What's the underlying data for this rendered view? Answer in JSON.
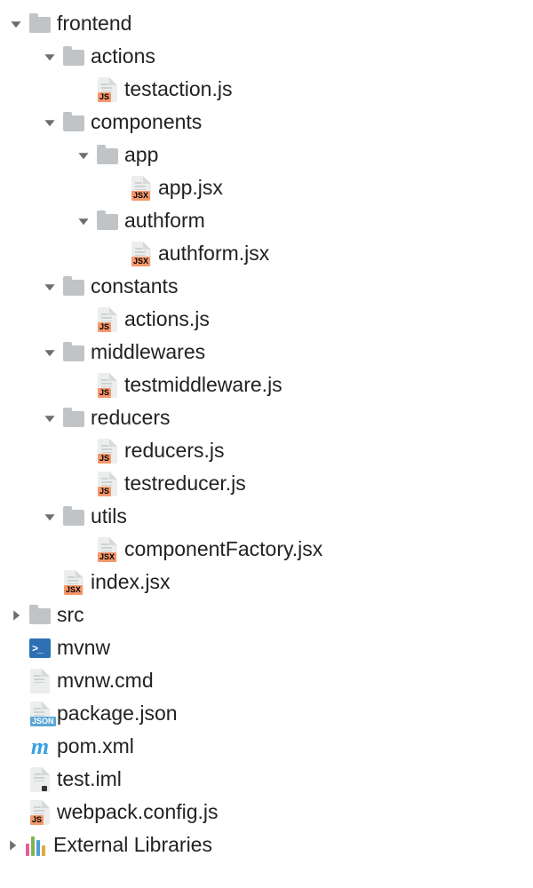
{
  "nodes": [
    {
      "depth": 0,
      "arrow": "down",
      "icon": "folder",
      "label": "frontend"
    },
    {
      "depth": 1,
      "arrow": "down",
      "icon": "folder",
      "label": "actions"
    },
    {
      "depth": 2,
      "arrow": "none",
      "icon": "js",
      "label": "testaction.js"
    },
    {
      "depth": 1,
      "arrow": "down",
      "icon": "folder",
      "label": "components"
    },
    {
      "depth": 2,
      "arrow": "down",
      "icon": "folder",
      "label": "app"
    },
    {
      "depth": 3,
      "arrow": "none",
      "icon": "jsx",
      "label": "app.jsx"
    },
    {
      "depth": 2,
      "arrow": "down",
      "icon": "folder",
      "label": "authform"
    },
    {
      "depth": 3,
      "arrow": "none",
      "icon": "jsx",
      "label": "authform.jsx"
    },
    {
      "depth": 1,
      "arrow": "down",
      "icon": "folder",
      "label": "constants"
    },
    {
      "depth": 2,
      "arrow": "none",
      "icon": "js",
      "label": "actions.js"
    },
    {
      "depth": 1,
      "arrow": "down",
      "icon": "folder",
      "label": "middlewares"
    },
    {
      "depth": 2,
      "arrow": "none",
      "icon": "js",
      "label": "testmiddleware.js"
    },
    {
      "depth": 1,
      "arrow": "down",
      "icon": "folder",
      "label": "reducers"
    },
    {
      "depth": 2,
      "arrow": "none",
      "icon": "js",
      "label": "reducers.js"
    },
    {
      "depth": 2,
      "arrow": "none",
      "icon": "js",
      "label": "testreducer.js"
    },
    {
      "depth": 1,
      "arrow": "down",
      "icon": "folder",
      "label": "utils"
    },
    {
      "depth": 2,
      "arrow": "none",
      "icon": "jsx",
      "label": "componentFactory.jsx"
    },
    {
      "depth": 1,
      "arrow": "none",
      "icon": "jsx",
      "label": "index.jsx"
    },
    {
      "depth": 0,
      "arrow": "right",
      "icon": "folder",
      "label": "src"
    },
    {
      "depth": 0,
      "arrow": "none",
      "icon": "term",
      "label": "mvnw"
    },
    {
      "depth": 0,
      "arrow": "none",
      "icon": "text",
      "label": "mvnw.cmd"
    },
    {
      "depth": 0,
      "arrow": "none",
      "icon": "json",
      "label": "package.json"
    },
    {
      "depth": 0,
      "arrow": "none",
      "icon": "maven",
      "label": "pom.xml"
    },
    {
      "depth": 0,
      "arrow": "none",
      "icon": "iml",
      "label": "test.iml"
    },
    {
      "depth": 0,
      "arrow": "none",
      "icon": "js",
      "label": "webpack.config.js"
    },
    {
      "depth": -1,
      "arrow": "right",
      "icon": "lib",
      "label": "External Libraries"
    }
  ],
  "badges": {
    "js": "JS",
    "jsx": "JSX",
    "json": "JSON"
  }
}
